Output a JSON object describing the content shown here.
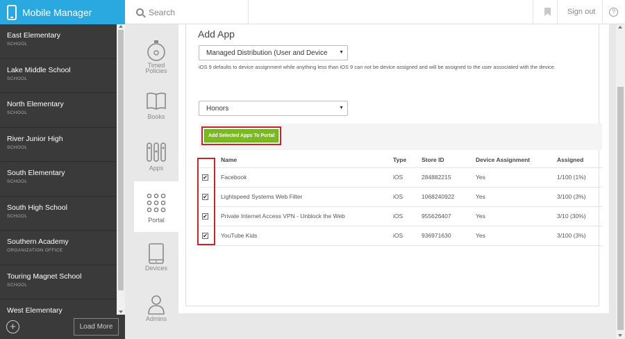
{
  "app": {
    "title": "Mobile Manager",
    "accent": "#29a9e0"
  },
  "header": {
    "search_label": "Search",
    "signout_label": "Sign out",
    "help_glyph": "?"
  },
  "sidebar": {
    "schools": [
      {
        "name": "East Elementary",
        "type": "SCHOOL"
      },
      {
        "name": "Lake Middle School",
        "type": "SCHOOL"
      },
      {
        "name": "North Elementary",
        "type": "SCHOOL"
      },
      {
        "name": "River Junior High",
        "type": "SCHOOL"
      },
      {
        "name": "South Elementary",
        "type": "SCHOOL"
      },
      {
        "name": "South High School",
        "type": "SCHOOL"
      },
      {
        "name": "Southern Academy",
        "type": "ORGANIZATION OFFICE"
      },
      {
        "name": "Touring Magnet School",
        "type": "SCHOOL"
      },
      {
        "name": "West Elementary",
        "type": ""
      }
    ],
    "load_more_label": "Load More",
    "add_glyph": "+"
  },
  "nav": {
    "timed_policies_1": "Timed",
    "timed_policies_2": "Policies",
    "books": "Books",
    "apps": "Apps",
    "portal": "Portal",
    "devices": "Devices",
    "admins": "Admins"
  },
  "main": {
    "title": "Add App",
    "distribution_select": "Managed Distribution (User and Device",
    "note": "iOS 9 defaults to device assignment while anything less than iOS 9 can not be device assigned and will be assigned to the user associated with the device.",
    "portal_select": "Honors",
    "add_button_label": "Add Selected Apps To Portal",
    "columns": {
      "name": "Name",
      "type": "Type",
      "store_id": "Store ID",
      "device_assignment": "Device Assignment",
      "assigned": "Assigned"
    },
    "rows": [
      {
        "name": "Facebook",
        "type": "iOS",
        "store_id": "284882215",
        "device_assignment": "Yes",
        "assigned": "1/100 (1%)",
        "checked": "✔"
      },
      {
        "name": "Lightspeed Systems Web Filter",
        "type": "iOS",
        "store_id": "1068240922",
        "device_assignment": "Yes",
        "assigned": "3/100 (3%)",
        "checked": "✔"
      },
      {
        "name": "Private Internet Access VPN - Unblock the Web",
        "type": "iOS",
        "store_id": "955626407",
        "device_assignment": "Yes",
        "assigned": "3/10 (30%)",
        "checked": "✔"
      },
      {
        "name": "YouTube Kids",
        "type": "iOS",
        "store_id": "936971630",
        "device_assignment": "Yes",
        "assigned": "3/100 (3%)",
        "checked": "✔"
      }
    ],
    "highlight_color": "#c0272d",
    "button_color": "#7cbb1f"
  }
}
